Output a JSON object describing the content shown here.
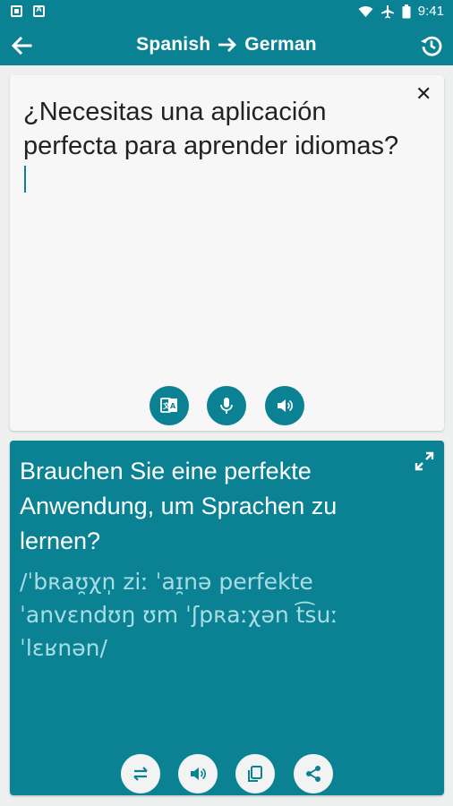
{
  "status_bar": {
    "time": "9:41"
  },
  "app_bar": {
    "source_language": "Spanish",
    "target_language": "German"
  },
  "source": {
    "text": "¿Necesitas una aplicación perfecta para aprender idiomas?"
  },
  "target": {
    "translation": "Brauchen Sie eine perfekte Anwendung, um Sprachen zu lernen?",
    "pronunciation": "/ˈbʀaʊ̯χn̩ ziː ˈaɪ̯nə perfekte ˈanvɛndʊŋ ʊm ˈʃpʀaːχən t͡suː ˈlɛʁnən/"
  },
  "icons": {
    "back": "arrow-left-icon",
    "history": "history-icon",
    "clear": "close-icon",
    "dictionary": "translate-book-icon",
    "mic": "mic-icon",
    "speaker": "volume-icon",
    "expand": "expand-icon",
    "swap": "swap-icon",
    "copy": "copy-icon",
    "share": "share-icon"
  },
  "colors": {
    "primary": "#0b8294",
    "pronunciation": "#a9dde4",
    "background": "#eef0f0"
  }
}
